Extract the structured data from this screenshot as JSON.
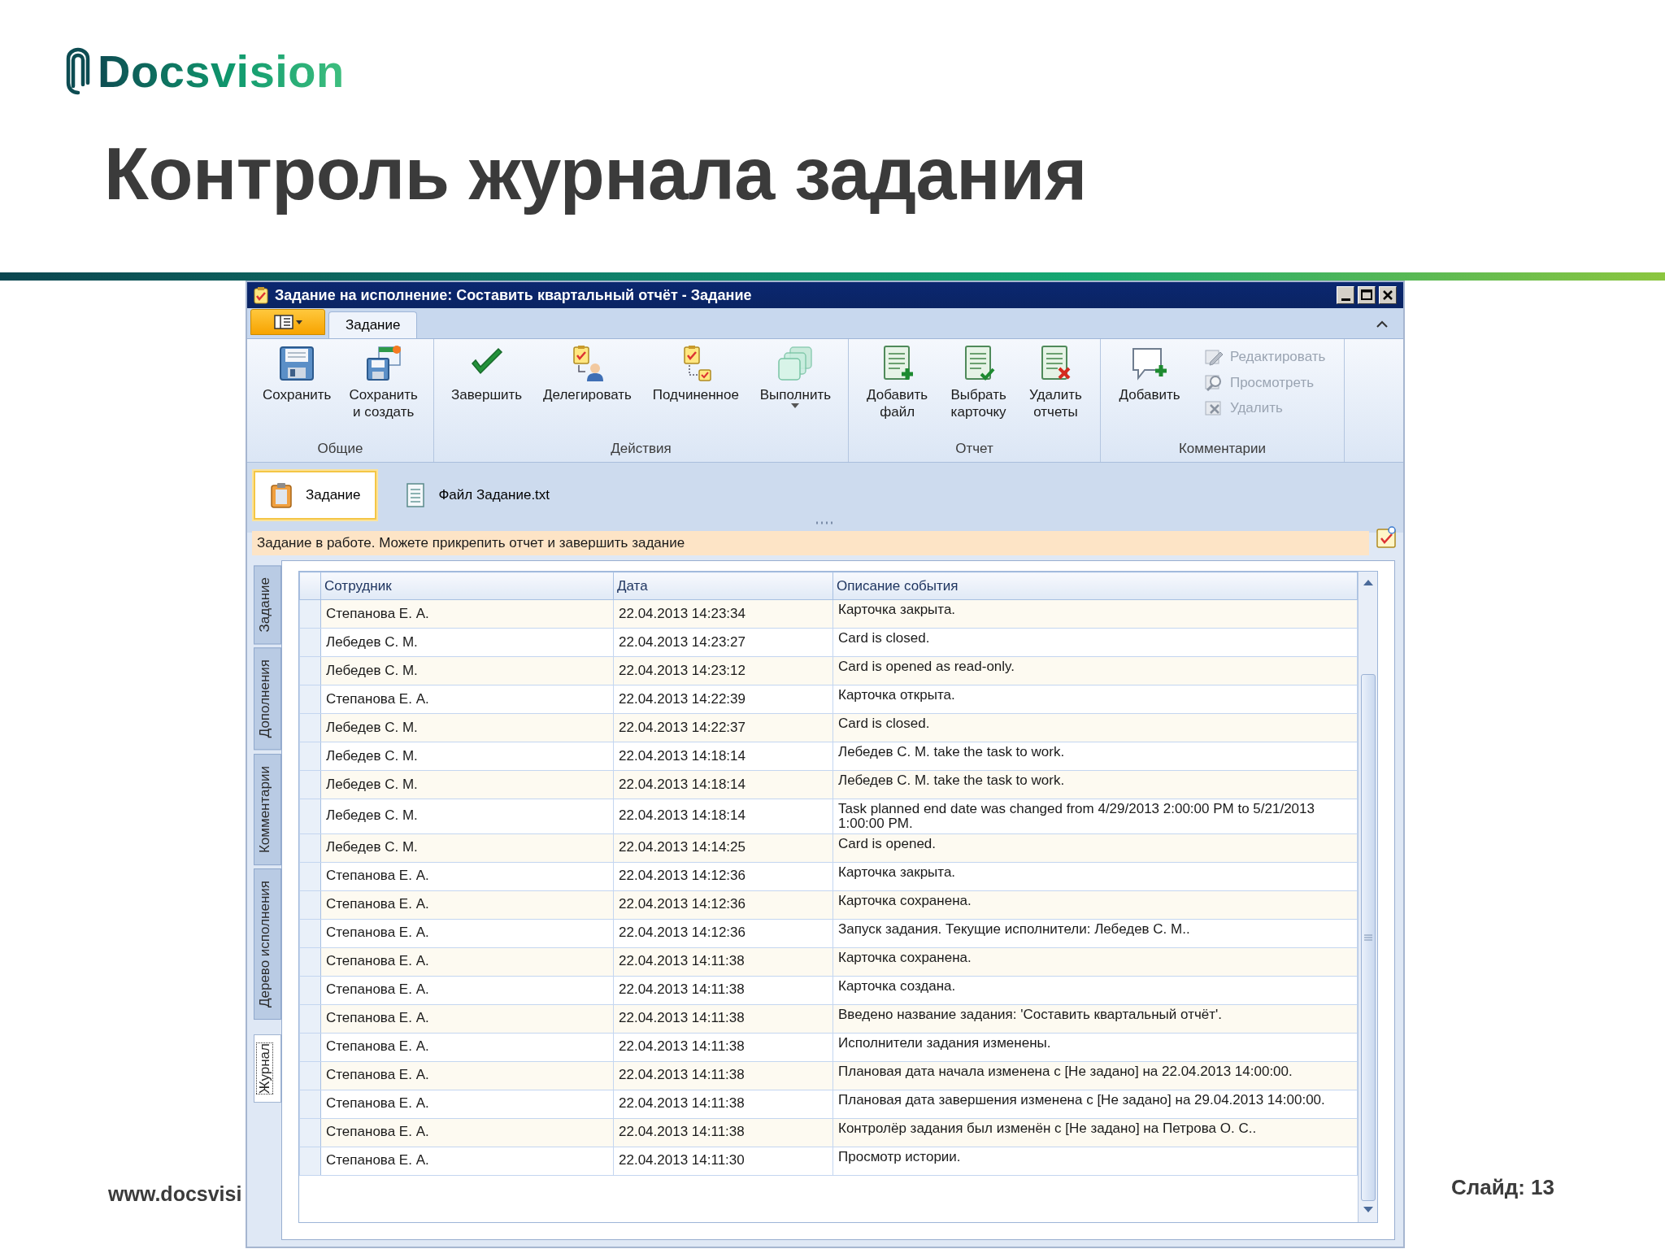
{
  "slide": {
    "logo": "Docsvision",
    "title": "Контроль журнала задания",
    "footer_url": "www.docsvisi",
    "slide_number": "Слайд: 13"
  },
  "window": {
    "title": "Задание на исполнение: Составить квартальный отчёт - Задание"
  },
  "ribbon_tabs": [
    {
      "label": "Задание",
      "selected": true
    }
  ],
  "ribbon_groups": [
    {
      "label": "Общие",
      "buttons": [
        {
          "kind": "large",
          "label": "Сохранить",
          "disabled": false,
          "dropdown": false
        },
        {
          "kind": "large",
          "label": "Сохранить\nи создать",
          "disabled": false,
          "dropdown": false
        }
      ]
    },
    {
      "label": "Действия",
      "buttons": [
        {
          "kind": "large",
          "label": "Завершить",
          "disabled": false,
          "dropdown": false
        },
        {
          "kind": "large",
          "label": "Делегировать",
          "disabled": false,
          "dropdown": false
        },
        {
          "kind": "large",
          "label": "Подчиненное",
          "disabled": false,
          "dropdown": false
        },
        {
          "kind": "large",
          "label": "Выполнить",
          "disabled": false,
          "dropdown": true
        }
      ]
    },
    {
      "label": "Отчет",
      "buttons": [
        {
          "kind": "large",
          "label": "Добавить\nфайл",
          "disabled": false,
          "dropdown": false
        },
        {
          "kind": "large",
          "label": "Выбрать\nкарточку",
          "disabled": false,
          "dropdown": false
        },
        {
          "kind": "large",
          "label": "Удалить\nотчеты",
          "disabled": false,
          "dropdown": false
        }
      ]
    },
    {
      "label": "Комментарии",
      "buttons": [
        {
          "kind": "large",
          "label": "Добавить",
          "disabled": false,
          "dropdown": false
        },
        {
          "kind": "small",
          "label": "Редактировать",
          "disabled": true,
          "dropdown": false
        },
        {
          "kind": "small",
          "label": "Просмотреть",
          "disabled": true,
          "dropdown": false
        },
        {
          "kind": "small",
          "label": "Удалить",
          "disabled": true,
          "dropdown": false
        }
      ]
    }
  ],
  "doc_tabs": [
    {
      "label": "Задание",
      "selected": true
    },
    {
      "label": "Файл Задание.txt",
      "selected": false
    }
  ],
  "info_bar": {
    "text": "Задание в работе. Можете прикрепить отчет и завершить задание"
  },
  "side_tabs": [
    {
      "label": "Задание",
      "selected": false
    },
    {
      "label": "Дополнения",
      "selected": false
    },
    {
      "label": "Комментарии",
      "selected": false
    },
    {
      "label": "Дерево исполнения",
      "selected": false
    },
    {
      "label": "Журнал",
      "selected": true
    }
  ],
  "table": {
    "columns": [
      "Сотрудник",
      "Дата",
      "Описание события"
    ],
    "rows": [
      {
        "employee": "Степанова Е. А.",
        "date": "22.04.2013 14:23:34",
        "description": "Карточка закрыта."
      },
      {
        "employee": "Лебедев С. М.",
        "date": "22.04.2013 14:23:27",
        "description": "Card is closed."
      },
      {
        "employee": "Лебедев С. М.",
        "date": "22.04.2013 14:23:12",
        "description": "Card is opened as read-only."
      },
      {
        "employee": "Степанова Е. А.",
        "date": "22.04.2013 14:22:39",
        "description": "Карточка открыта."
      },
      {
        "employee": "Лебедев С. М.",
        "date": "22.04.2013 14:22:37",
        "description": "Card is closed."
      },
      {
        "employee": "Лебедев С. М.",
        "date": "22.04.2013 14:18:14",
        "description": "Лебедев С. М. take the task to work."
      },
      {
        "employee": "Лебедев С. М.",
        "date": "22.04.2013 14:18:14",
        "description": "Лебедев С. М. take the task to work."
      },
      {
        "employee": "Лебедев С. М.",
        "date": "22.04.2013 14:18:14",
        "description": "Task planned end date was changed from 4/29/2013 2:00:00 PM to 5/21/2013 1:00:00 PM."
      },
      {
        "employee": "Лебедев С. М.",
        "date": "22.04.2013 14:14:25",
        "description": "Card is opened."
      },
      {
        "employee": "Степанова Е. А.",
        "date": "22.04.2013 14:12:36",
        "description": "Карточка закрыта."
      },
      {
        "employee": "Степанова Е. А.",
        "date": "22.04.2013 14:12:36",
        "description": "Карточка сохранена."
      },
      {
        "employee": "Степанова Е. А.",
        "date": "22.04.2013 14:12:36",
        "description": "Запуск задания. Текущие исполнители: Лебедев С. М.."
      },
      {
        "employee": "Степанова Е. А.",
        "date": "22.04.2013 14:11:38",
        "description": "Карточка сохранена."
      },
      {
        "employee": "Степанова Е. А.",
        "date": "22.04.2013 14:11:38",
        "description": "Карточка создана."
      },
      {
        "employee": "Степанова Е. А.",
        "date": "22.04.2013 14:11:38",
        "description": "Введено название задания: 'Составить квартальный отчёт'."
      },
      {
        "employee": "Степанова Е. А.",
        "date": "22.04.2013 14:11:38",
        "description": "Исполнители задания изменены."
      },
      {
        "employee": "Степанова Е. А.",
        "date": "22.04.2013 14:11:38",
        "description": "Плановая дата начала изменена с [Не задано] на 22.04.2013 14:00:00."
      },
      {
        "employee": "Степанова Е. А.",
        "date": "22.04.2013 14:11:38",
        "description": "Плановая дата завершения изменена с [Не задано] на 29.04.2013 14:00:00."
      },
      {
        "employee": "Степанова Е. А.",
        "date": "22.04.2013 14:11:38",
        "description": "Контролёр задания был изменён с [Не задано] на Петрова О. С.."
      },
      {
        "employee": "Степанова Е. А.",
        "date": "22.04.2013 14:11:30",
        "description": "Просмотр истории."
      }
    ]
  }
}
